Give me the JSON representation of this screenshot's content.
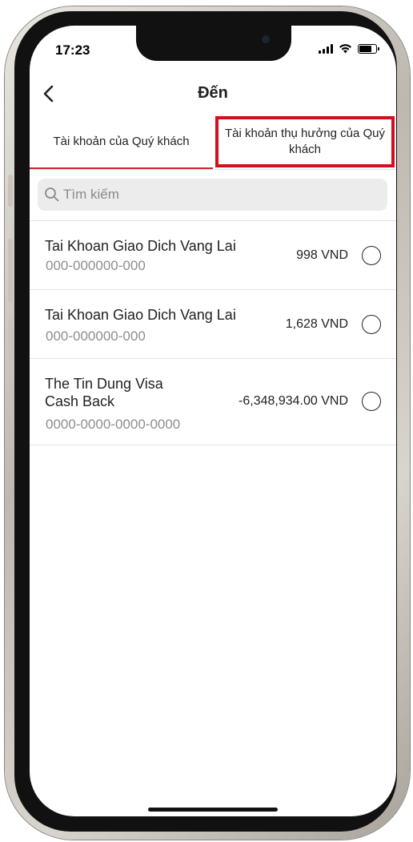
{
  "status_bar": {
    "time": "17:23"
  },
  "nav": {
    "title": "Đến"
  },
  "tabs": [
    {
      "label": "Tài khoản của Quý khách"
    },
    {
      "label": "Tài khoản thụ hưởng của Quý khách"
    }
  ],
  "search": {
    "placeholder": "Tìm kiếm"
  },
  "accounts": [
    {
      "name": "Tai Khoan Giao Dich Vang Lai",
      "number": "000-000000-000",
      "balance": "998 VND"
    },
    {
      "name": "Tai Khoan Giao Dich Vang Lai",
      "number": "000-000000-000",
      "balance": "1,628 VND"
    },
    {
      "name": "The Tin Dung Visa\nCash Back",
      "number": "0000-0000-0000-0000",
      "balance": "-6,348,934.00 VND"
    }
  ],
  "colors": {
    "accent_red": "#d2232a",
    "highlight_box": "#d0101c"
  },
  "icons": [
    "back-chevron-icon",
    "search-icon",
    "signal-icon",
    "wifi-icon",
    "battery-icon"
  ]
}
